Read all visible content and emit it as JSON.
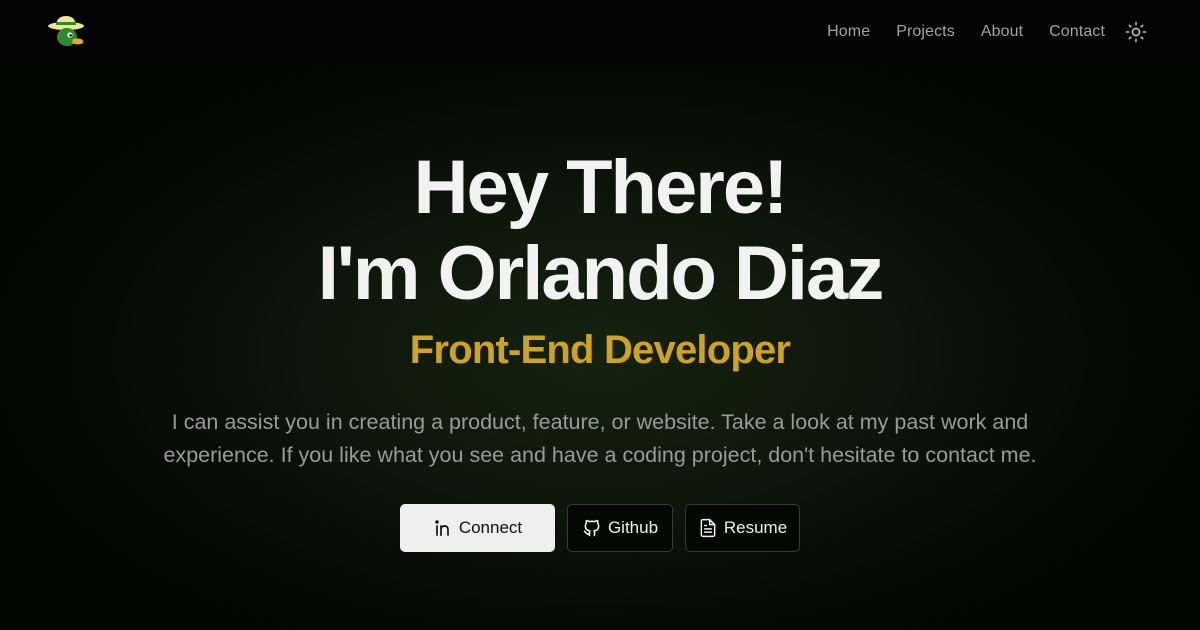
{
  "nav": {
    "logo_icon": "duck-with-hat-icon",
    "links": [
      {
        "label": "Home"
      },
      {
        "label": "Projects"
      },
      {
        "label": "About"
      },
      {
        "label": "Contact"
      }
    ],
    "theme_toggle_icon": "sun-icon"
  },
  "hero": {
    "headline_line1": "Hey There!",
    "headline_line2": "I'm Orlando Diaz",
    "role": "Front-End Developer",
    "intro": "I can assist you in creating a product, feature, or website. Take a look at my past work and experience. If you like what you see and have a coding project, don't hesitate to contact me.",
    "buttons": {
      "connect": {
        "label": "Connect",
        "icon": "linkedin-icon"
      },
      "github": {
        "label": "Github",
        "icon": "github-icon"
      },
      "resume": {
        "label": "Resume",
        "icon": "document-icon"
      }
    }
  },
  "colors": {
    "background": "#000000",
    "accent": "#cfa21f",
    "heading": "#f2f2f2",
    "muted_text": "#9a9a9a"
  }
}
